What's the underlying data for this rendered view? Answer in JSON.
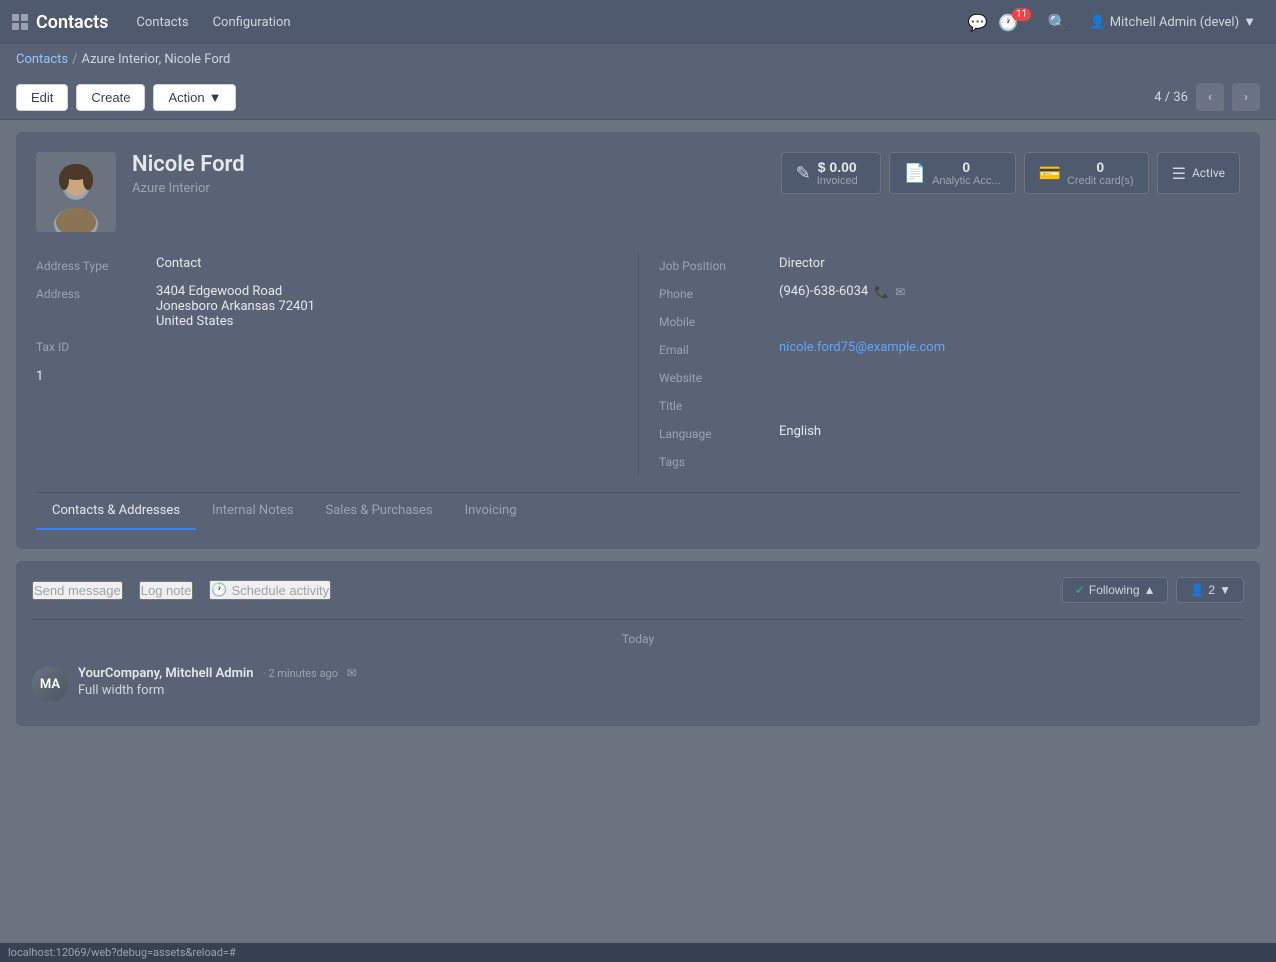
{
  "app": {
    "name": "Contacts",
    "nav_items": [
      "Contacts",
      "Configuration"
    ],
    "user": "Mitchell Admin (devel)",
    "notification_count": "11"
  },
  "breadcrumb": {
    "parent": "Contacts",
    "separator": "/",
    "current": "Azure Interior, Nicole Ford"
  },
  "toolbar": {
    "edit_label": "Edit",
    "create_label": "Create",
    "action_label": "Action",
    "nav_current": "4",
    "nav_total": "36"
  },
  "contact": {
    "name": "Nicole Ford",
    "company": "Azure Interior",
    "address_type_label": "Address Type",
    "address_type_value": "Contact",
    "address_label": "Address",
    "address_line1": "3404 Edgewood Road",
    "address_line2": "Jonesboro  Arkansas  72401",
    "address_line3": "United States",
    "tax_id_label": "Tax ID",
    "job_position_label": "Job Position",
    "job_position_value": "Director",
    "phone_label": "Phone",
    "phone_value": "(946)-638-6034",
    "mobile_label": "Mobile",
    "email_label": "Email",
    "email_value": "nicole.ford75@example.com",
    "website_label": "Website",
    "title_label": "Title",
    "language_label": "Language",
    "language_value": "English",
    "tags_label": "Tags",
    "smart_btns": {
      "invoiced": {
        "value": "$ 0.00",
        "label": "Invoiced"
      },
      "analytic": {
        "count": "0",
        "label": "Analytic Acc..."
      },
      "credit_cards": {
        "count": "0",
        "label": "Credit card(s)"
      },
      "active": {
        "label": "Active"
      }
    },
    "section_number": "1"
  },
  "tabs": [
    {
      "id": "contacts",
      "label": "Contacts & Addresses",
      "active": true
    },
    {
      "id": "notes",
      "label": "Internal Notes",
      "active": false
    },
    {
      "id": "sales",
      "label": "Sales & Purchases",
      "active": false
    },
    {
      "id": "invoicing",
      "label": "Invoicing",
      "active": false
    }
  ],
  "chatter": {
    "send_message": "Send message",
    "log_note": "Log note",
    "schedule_activity": "Schedule activity",
    "following_label": "Following",
    "followers_count": "2",
    "timeline_date": "Today",
    "message": {
      "author": "YourCompany, Mitchell Admin",
      "time": "2 minutes ago",
      "text": "Full width form"
    }
  },
  "status_bar": {
    "url": "localhost:12069/web?debug=assets&reload=#"
  }
}
